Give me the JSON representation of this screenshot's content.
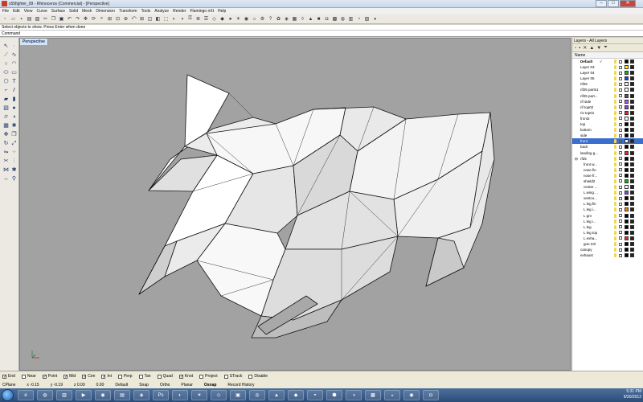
{
  "window": {
    "title": "x55fighter_09 - Rhinoceros (Commercial) - [Perspective]",
    "controls": [
      "–",
      "□",
      "✕"
    ]
  },
  "menu": [
    "File",
    "Edit",
    "View",
    "Curve",
    "Surface",
    "Solid",
    "Mesh",
    "Dimension",
    "Transform",
    "Tools",
    "Analyze",
    "Render",
    "Flamingo nXt",
    "Help"
  ],
  "command": {
    "history": "Select objects to show. Press Enter when done",
    "prompt": "Command"
  },
  "viewport": {
    "tab": "Perspective"
  },
  "layers": {
    "title": "Layers - All Layers",
    "column_header": "Name",
    "rows": [
      {
        "name": "Default",
        "check": "✓",
        "color": "#000000",
        "indent": 0,
        "bold": true
      },
      {
        "name": "Layer 03",
        "color": "#ffff00",
        "indent": 0
      },
      {
        "name": "Layer 04",
        "color": "#00c000",
        "indent": 0
      },
      {
        "name": "Layer 05",
        "color": "#0050ff",
        "indent": 0
      },
      {
        "name": "rif25",
        "color": "#ffffff",
        "indent": 0
      },
      {
        "name": "rif25 parts1",
        "color": "#ffffff",
        "indent": 0
      },
      {
        "name": "rif25 part...",
        "color": "#555555",
        "indent": 0
      },
      {
        "name": "rif side",
        "color": "#c050ff",
        "indent": 0
      },
      {
        "name": "rif top02",
        "color": "#9040ff",
        "indent": 0
      },
      {
        "name": "riv top01",
        "color": "#ff2020",
        "indent": 0
      },
      {
        "name": "front2",
        "color": "#ffffff",
        "indent": 0
      },
      {
        "name": "top",
        "color": "#000000",
        "indent": 0
      },
      {
        "name": "bottom",
        "color": "#000000",
        "indent": 0
      },
      {
        "name": "side",
        "color": "#000000",
        "indent": 0
      },
      {
        "name": "front",
        "color": "#ffffff",
        "indent": 0,
        "selected": true
      },
      {
        "name": "back",
        "color": "#000000",
        "indent": 0
      },
      {
        "name": "landing g...",
        "color": "#ff2020",
        "indent": 0
      },
      {
        "name": "rf25",
        "color": "#000000",
        "indent": 0,
        "expander": "⊟"
      },
      {
        "name": "front w...",
        "color": "#000000",
        "indent": 1
      },
      {
        "name": "nose fin",
        "color": "#000000",
        "indent": 1
      },
      {
        "name": "nose fr...",
        "color": "#000000",
        "indent": 1
      },
      {
        "name": "shield2",
        "color": "#00c000",
        "indent": 1
      },
      {
        "name": "center ...",
        "color": "#ffffff",
        "indent": 1
      },
      {
        "name": "L wing ...",
        "color": "#9040ff",
        "indent": 1
      },
      {
        "name": "ventco...",
        "color": "#000000",
        "indent": 1
      },
      {
        "name": "L leg fin",
        "color": "#000000",
        "indent": 1
      },
      {
        "name": "L leg i...",
        "color": "#ff8000",
        "indent": 1
      },
      {
        "name": "L gnr",
        "color": "#000000",
        "indent": 1
      },
      {
        "name": "L leg i...",
        "color": "#000000",
        "indent": 1
      },
      {
        "name": "L leg",
        "color": "#000000",
        "indent": 1
      },
      {
        "name": "L leg top",
        "color": "#000000",
        "indent": 1
      },
      {
        "name": "L exha...",
        "color": "#ff2020",
        "indent": 1
      },
      {
        "name": "gun mtl",
        "color": "#000000",
        "indent": 1
      },
      {
        "name": "canopy",
        "color": "#000000",
        "indent": 0
      },
      {
        "name": "exhaust",
        "color": "#000000",
        "indent": 0
      }
    ]
  },
  "osnaps": [
    {
      "label": "End",
      "checked": true
    },
    {
      "label": "Near",
      "checked": false
    },
    {
      "label": "Point",
      "checked": true
    },
    {
      "label": "Mid",
      "checked": true
    },
    {
      "label": "Cen",
      "checked": true
    },
    {
      "label": "Int",
      "checked": true
    },
    {
      "label": "Perp",
      "checked": false
    },
    {
      "label": "Tan",
      "checked": false
    },
    {
      "label": "Quad",
      "checked": false
    },
    {
      "label": "Knot",
      "checked": true
    },
    {
      "label": "Project",
      "checked": false
    },
    {
      "label": "STrack",
      "checked": false
    },
    {
      "label": "Disable",
      "checked": false
    }
  ],
  "status": {
    "cplane": "CPlane",
    "x": "x -0.15",
    "y": "y -0.19",
    "z": "z 0.00",
    "dist": "0.00",
    "layer": "Default",
    "toggles": [
      "Snap",
      "Ortho",
      "Planar",
      "Osnap",
      "Record History"
    ]
  },
  "tray": {
    "time": "5:31 PM",
    "date": "9/30/2012"
  }
}
